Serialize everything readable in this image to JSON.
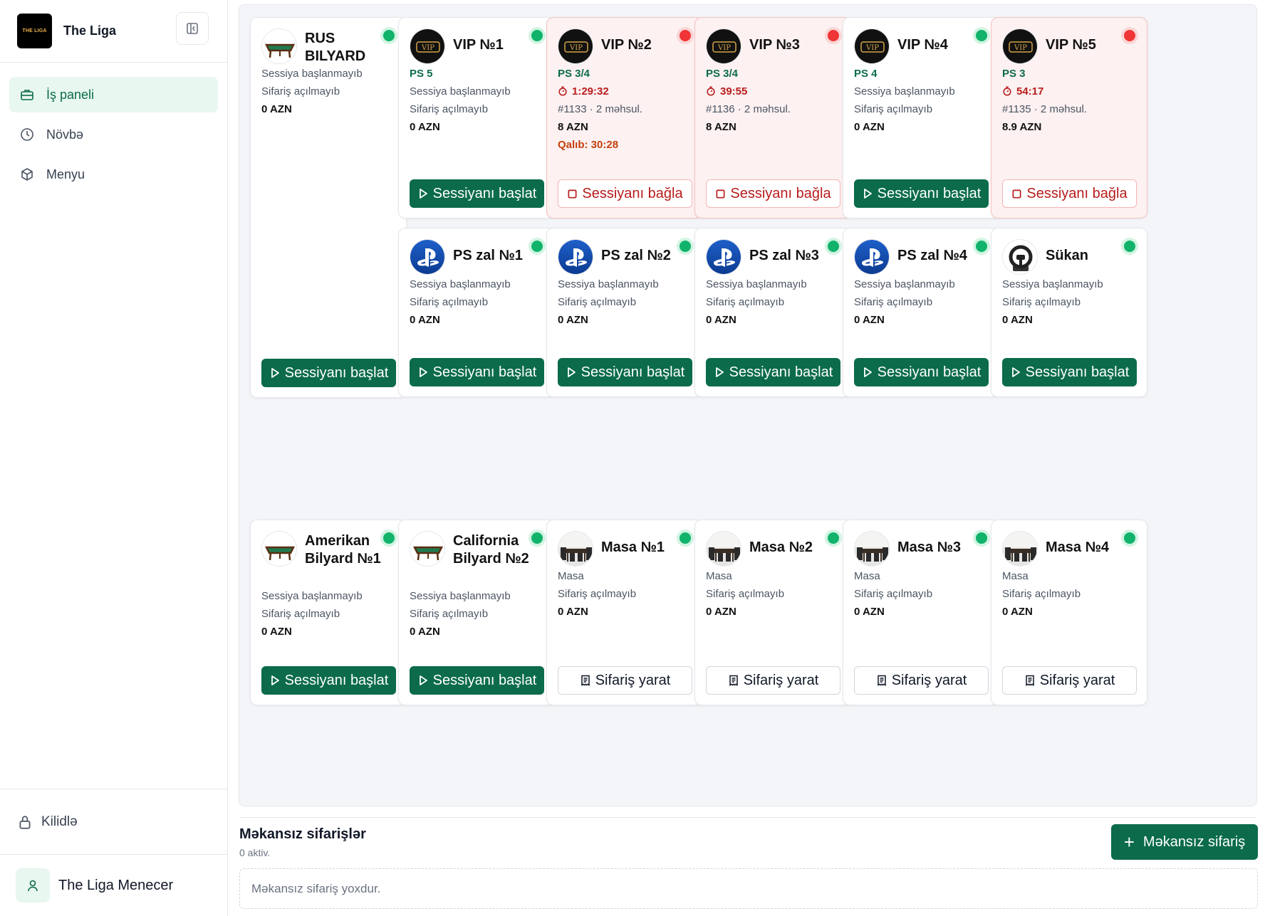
{
  "sidebar": {
    "logo_text": "THE LIGA",
    "brand": "The Liga",
    "nav": [
      {
        "label": "İş paneli",
        "icon": "briefcase-icon",
        "active": true
      },
      {
        "label": "Növbə",
        "icon": "clock-icon",
        "active": false
      },
      {
        "label": "Menyu",
        "icon": "box-icon",
        "active": false
      }
    ],
    "lock_label": "Kilidlə",
    "user_name": "The Liga Menecer"
  },
  "colors": {
    "primary": "#0b6b4b",
    "status_free": "#11b36b",
    "status_busy": "#ef3535",
    "busy_card_bg": "#fdf1f1"
  },
  "cards": [
    {
      "name": "RUS BILYARD",
      "thumb": "billiard",
      "status": "free",
      "lines": [
        {
          "t": "Sessiya başlanmayıb",
          "k": "muted"
        },
        {
          "t": "Sifariş açılmayıb",
          "k": "muted"
        },
        {
          "t": "0 AZN",
          "k": "amount"
        }
      ],
      "button": {
        "label": "Sessiyanı başlat",
        "kind": "start"
      }
    },
    {
      "name": "VIP №1",
      "thumb": "vip",
      "status": "free",
      "lines": [
        {
          "t": "PS 5",
          "k": "ps"
        },
        {
          "t": "Sessiya başlanmayıb",
          "k": "muted"
        },
        {
          "t": "Sifariş açılmayıb",
          "k": "muted"
        },
        {
          "t": "0 AZN",
          "k": "amount"
        }
      ],
      "button": {
        "label": "Sessiyanı başlat",
        "kind": "start"
      }
    },
    {
      "name": "VIP №2",
      "thumb": "vip",
      "status": "busy",
      "lines": [
        {
          "t": "PS 3/4",
          "k": "ps"
        },
        {
          "t": "1:29:32",
          "k": "timer"
        },
        {
          "t": "#1133 · 2 məhsul.",
          "k": "muted"
        },
        {
          "t": "8 AZN",
          "k": "amount"
        },
        {
          "t": "Qalıb: 30:28",
          "k": "limit"
        }
      ],
      "button": {
        "label": "Sessiyanı bağla",
        "kind": "stop"
      }
    },
    {
      "name": "VIP №3",
      "thumb": "vip",
      "status": "busy",
      "lines": [
        {
          "t": "PS 3/4",
          "k": "ps"
        },
        {
          "t": "39:55",
          "k": "timer"
        },
        {
          "t": "#1136 · 2 məhsul.",
          "k": "muted"
        },
        {
          "t": "8 AZN",
          "k": "amount"
        }
      ],
      "button": {
        "label": "Sessiyanı bağla",
        "kind": "stop"
      }
    },
    {
      "name": "VIP №4",
      "thumb": "vip",
      "status": "free",
      "lines": [
        {
          "t": "PS 4",
          "k": "ps"
        },
        {
          "t": "Sessiya başlanmayıb",
          "k": "muted"
        },
        {
          "t": "Sifariş açılmayıb",
          "k": "muted"
        },
        {
          "t": "0 AZN",
          "k": "amount"
        }
      ],
      "button": {
        "label": "Sessiyanı başlat",
        "kind": "start"
      }
    },
    {
      "name": "VIP №5",
      "thumb": "vip",
      "status": "busy",
      "lines": [
        {
          "t": "PS 3",
          "k": "ps"
        },
        {
          "t": "54:17",
          "k": "timer"
        },
        {
          "t": "#1135 · 2 məhsul.",
          "k": "muted"
        },
        {
          "t": "8.9 AZN",
          "k": "amount"
        }
      ],
      "button": {
        "label": "Sessiyanı bağla",
        "kind": "stop"
      }
    },
    {
      "name": "PS zal №1",
      "thumb": "playstation",
      "status": "free",
      "lines": [
        {
          "t": "Sessiya başlanmayıb",
          "k": "muted"
        },
        {
          "t": "Sifariş açılmayıb",
          "k": "muted"
        },
        {
          "t": "0 AZN",
          "k": "amount"
        }
      ],
      "button": {
        "label": "Sessiyanı başlat",
        "kind": "start"
      }
    },
    {
      "name": "PS zal №2",
      "thumb": "playstation",
      "status": "free",
      "lines": [
        {
          "t": "Sessiya başlanmayıb",
          "k": "muted"
        },
        {
          "t": "Sifariş açılmayıb",
          "k": "muted"
        },
        {
          "t": "0 AZN",
          "k": "amount"
        }
      ],
      "button": {
        "label": "Sessiyanı başlat",
        "kind": "start"
      }
    },
    {
      "name": "PS zal №3",
      "thumb": "playstation",
      "status": "free",
      "lines": [
        {
          "t": "Sessiya başlanmayıb",
          "k": "muted"
        },
        {
          "t": "Sifariş açılmayıb",
          "k": "muted"
        },
        {
          "t": "0 AZN",
          "k": "amount"
        }
      ],
      "button": {
        "label": "Sessiyanı başlat",
        "kind": "start"
      }
    },
    {
      "name": "PS zal №4",
      "thumb": "playstation",
      "status": "free",
      "lines": [
        {
          "t": "Sessiya başlanmayıb",
          "k": "muted"
        },
        {
          "t": "Sifariş açılmayıb",
          "k": "muted"
        },
        {
          "t": "0 AZN",
          "k": "amount"
        }
      ],
      "button": {
        "label": "Sessiyanı başlat",
        "kind": "start"
      }
    },
    {
      "name": "Sükan",
      "thumb": "wheel",
      "status": "free",
      "lines": [
        {
          "t": "Sessiya başlanmayıb",
          "k": "muted"
        },
        {
          "t": "Sifariş açılmayıb",
          "k": "muted"
        },
        {
          "t": "0 AZN",
          "k": "amount"
        }
      ],
      "button": {
        "label": "Sessiyanı başlat",
        "kind": "start"
      }
    },
    {
      "name": "Amerikan Bilyard №1",
      "thumb": "billiard",
      "status": "free",
      "lines": [
        {
          "t": "Sessiya başlanmayıb",
          "k": "muted"
        },
        {
          "t": "Sifariş açılmayıb",
          "k": "muted"
        },
        {
          "t": "0 AZN",
          "k": "amount"
        }
      ],
      "button": {
        "label": "Sessiyanı başlat",
        "kind": "start"
      }
    },
    {
      "name": "California Bilyard №2",
      "thumb": "billiard",
      "status": "free",
      "lines": [
        {
          "t": "Sessiya başlanmayıb",
          "k": "muted"
        },
        {
          "t": "Sifariş açılmayıb",
          "k": "muted"
        },
        {
          "t": "0 AZN",
          "k": "amount"
        }
      ],
      "button": {
        "label": "Sessiyanı başlat",
        "kind": "start"
      }
    },
    {
      "name": "Masa №1",
      "thumb": "table",
      "status": "free",
      "lines": [
        {
          "t": "Masa",
          "k": "muted"
        },
        {
          "t": "Sifariş açılmayıb",
          "k": "muted"
        },
        {
          "t": "0 AZN",
          "k": "amount"
        }
      ],
      "button": {
        "label": "Sifariş yarat",
        "kind": "order"
      }
    },
    {
      "name": "Masa №2",
      "thumb": "table",
      "status": "free",
      "lines": [
        {
          "t": "Masa",
          "k": "muted"
        },
        {
          "t": "Sifariş açılmayıb",
          "k": "muted"
        },
        {
          "t": "0 AZN",
          "k": "amount"
        }
      ],
      "button": {
        "label": "Sifariş yarat",
        "kind": "order"
      }
    },
    {
      "name": "Masa №3",
      "thumb": "table",
      "status": "free",
      "lines": [
        {
          "t": "Masa",
          "k": "muted"
        },
        {
          "t": "Sifariş açılmayıb",
          "k": "muted"
        },
        {
          "t": "0 AZN",
          "k": "amount"
        }
      ],
      "button": {
        "label": "Sifariş yarat",
        "kind": "order"
      }
    },
    {
      "name": "Masa №4",
      "thumb": "table",
      "status": "free",
      "lines": [
        {
          "t": "Masa",
          "k": "muted"
        },
        {
          "t": "Sifariş açılmayıb",
          "k": "muted"
        },
        {
          "t": "0 AZN",
          "k": "amount"
        }
      ],
      "button": {
        "label": "Sifariş yarat",
        "kind": "order"
      }
    }
  ],
  "orders": {
    "title": "Məkansız sifarişlər",
    "subtitle": "0 aktiv.",
    "add_label": "Məkansız sifariş",
    "empty_text": "Məkansız sifariş yoxdur."
  }
}
